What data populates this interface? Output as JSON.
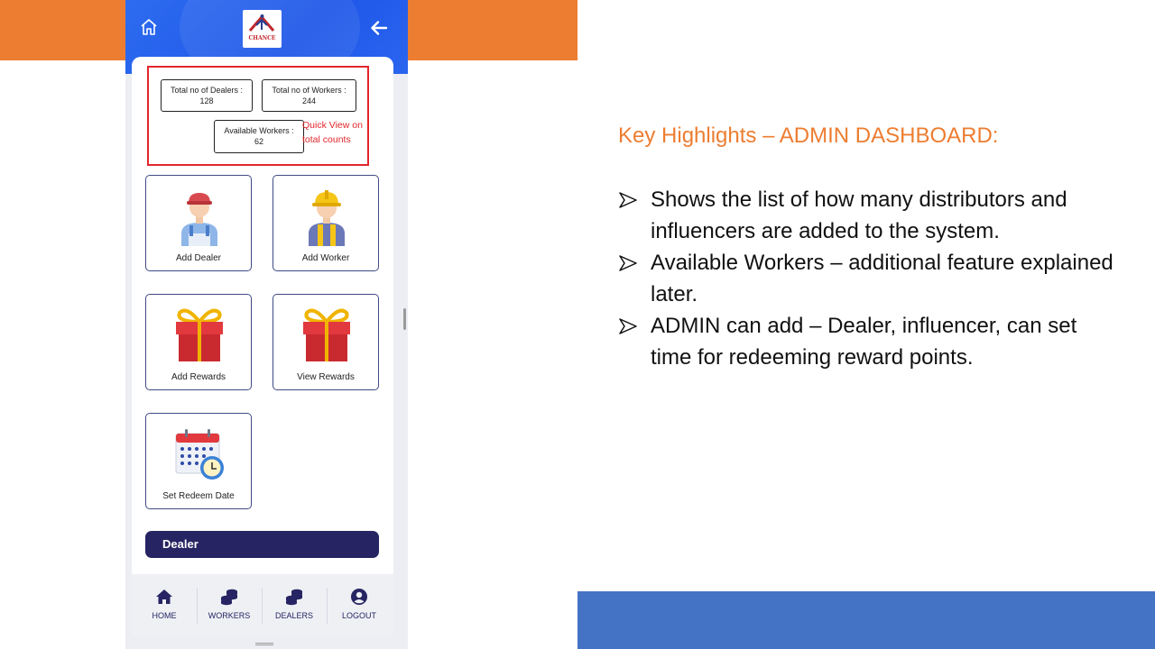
{
  "phone": {
    "logo_text": "CHANCE",
    "stats": {
      "dealers_label": "Total no of Dealers :",
      "dealers_value": "128",
      "workers_label": "Total no of Workers :",
      "workers_value": "244",
      "available_label": "Available Workers :",
      "available_value": "62"
    },
    "annotation": "Quick View on total counts",
    "tiles": [
      {
        "label": "Add Dealer",
        "icon": "dealer-avatar-icon"
      },
      {
        "label": "Add Worker",
        "icon": "worker-avatar-icon"
      },
      {
        "label": "Add Rewards",
        "icon": "gift-icon"
      },
      {
        "label": "View Rewards",
        "icon": "gift-icon"
      },
      {
        "label": "Set Redeem Date",
        "icon": "calendar-clock-icon"
      }
    ],
    "dealer_section": "Dealer",
    "nav": [
      {
        "label": "HOME",
        "icon": "home-icon"
      },
      {
        "label": "WORKERS",
        "icon": "coins-icon"
      },
      {
        "label": "DEALERS",
        "icon": "coins-icon"
      },
      {
        "label": "LOGOUT",
        "icon": "user-circle-icon"
      }
    ]
  },
  "slide": {
    "title": "Key Highlights – ADMIN DASHBOARD:",
    "bullets": [
      "Shows the list of how many distributors and influencers are added to the system.",
      "Available Workers – additional feature explained later.",
      "ADMIN can add – Dealer, influencer, can set time for redeeming reward points."
    ]
  },
  "colors": {
    "orange": "#ED7D31",
    "blue": "#4472C4",
    "header_blue": "#2060EE",
    "navy": "#262462",
    "highlight_red": "#E3262B"
  }
}
